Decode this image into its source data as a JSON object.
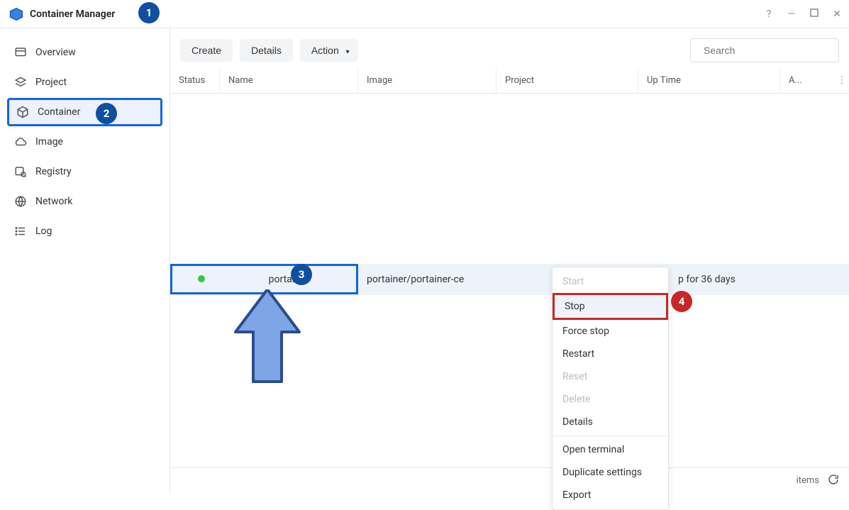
{
  "app": {
    "title": "Container Manager"
  },
  "sidebar": {
    "items": [
      {
        "label": "Overview"
      },
      {
        "label": "Project"
      },
      {
        "label": "Container"
      },
      {
        "label": "Image"
      },
      {
        "label": "Registry"
      },
      {
        "label": "Network"
      },
      {
        "label": "Log"
      }
    ]
  },
  "toolbar": {
    "create_label": "Create",
    "details_label": "Details",
    "action_label": "Action"
  },
  "search": {
    "placeholder": "Search"
  },
  "table": {
    "headers": {
      "status": "Status",
      "name": "Name",
      "image": "Image",
      "project": "Project",
      "uptime": "Up Time",
      "a": "A..."
    },
    "rows": [
      {
        "name": "portainer",
        "image": "portainer/portainer-ce",
        "project": "-",
        "uptime": "p for 36 days"
      }
    ]
  },
  "context_menu": {
    "items": [
      {
        "label": "Start",
        "disabled": true
      },
      {
        "label": "Stop",
        "disabled": false,
        "highlighted": true
      },
      {
        "label": "Force stop",
        "disabled": false
      },
      {
        "label": "Restart",
        "disabled": false
      },
      {
        "label": "Reset",
        "disabled": true
      },
      {
        "label": "Delete",
        "disabled": true
      },
      {
        "label": "Details",
        "disabled": false
      },
      {
        "label": "Open terminal",
        "disabled": false
      },
      {
        "label": "Duplicate settings",
        "disabled": false
      },
      {
        "label": "Export",
        "disabled": false
      }
    ]
  },
  "statusbar": {
    "items_label": "items"
  },
  "annotations": {
    "n1": "1",
    "n2": "2",
    "n3": "3",
    "n4": "4"
  }
}
